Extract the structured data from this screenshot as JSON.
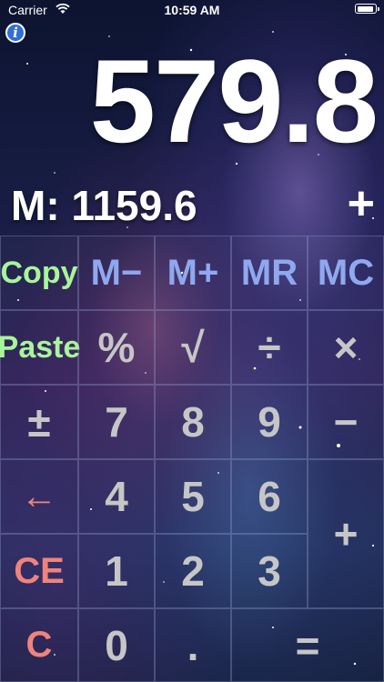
{
  "status_bar": {
    "carrier": "Carrier",
    "time": "10:59 AM",
    "battery_level": 0.95
  },
  "info_button": {
    "label": "i"
  },
  "display": {
    "value": "579.8",
    "memory": "M: 1159.6",
    "pending_operator": "+"
  },
  "keys": {
    "copy": "Copy",
    "m_minus": "M−",
    "m_plus": "M+",
    "mr": "MR",
    "mc": "MC",
    "paste": "Paste",
    "percent": "%",
    "sqrt": "√",
    "divide": "÷",
    "multiply": "×",
    "plus_minus": "±",
    "seven": "7",
    "eight": "8",
    "nine": "9",
    "minus": "−",
    "backspace": "←",
    "four": "4",
    "five": "5",
    "six": "6",
    "plus": "+",
    "ce": "CE",
    "one": "1",
    "two": "2",
    "three": "3",
    "c": "C",
    "zero": "0",
    "dot": ".",
    "equals": "="
  },
  "colors": {
    "function_key": "#a9f59a",
    "memory_key": "#8fa8ef",
    "digit_key": "#c6c6c6",
    "clear_key": "#f0837c",
    "display_text": "#ffffff"
  }
}
